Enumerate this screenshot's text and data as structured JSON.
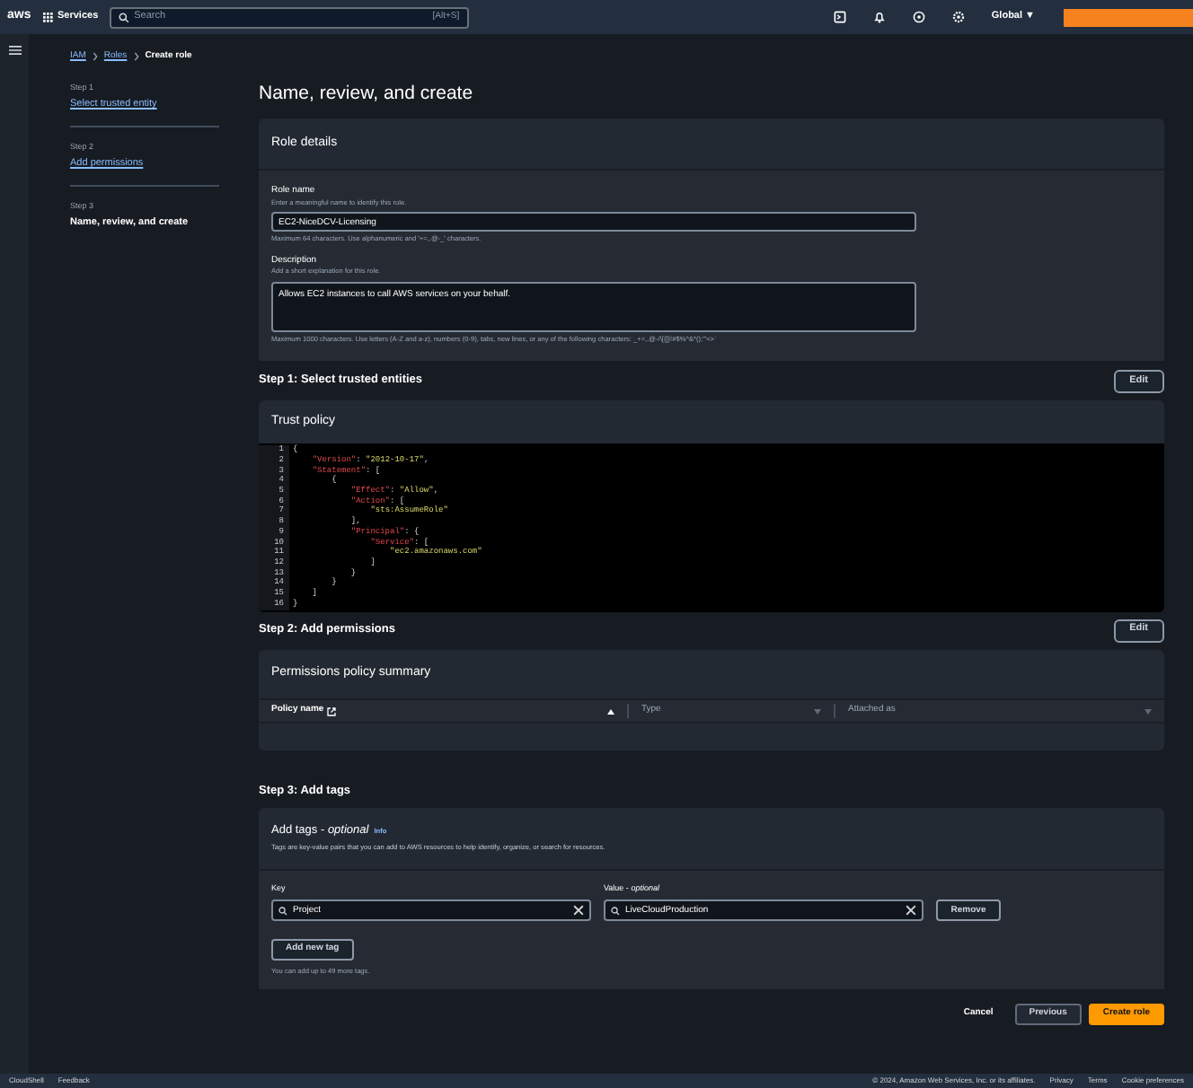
{
  "top_bar": {
    "logo": "aws",
    "services": "Services",
    "search": {
      "placeholder": "Search",
      "shortcut": "[Alt+S]"
    },
    "region": "Global ▼"
  },
  "breadcrumb": [
    {
      "label": "IAM",
      "link": true
    },
    {
      "label": "Roles",
      "link": true
    },
    {
      "label": "Create role",
      "link": false
    }
  ],
  "steps": [
    {
      "step": "Step 1",
      "label": "Select trusted entity",
      "selected": false
    },
    {
      "step": "Step 2",
      "label": "Add permissions",
      "selected": false
    },
    {
      "step": "Step 3",
      "label": "Name, review, and create",
      "selected": true
    }
  ],
  "title": "Name, review, and create",
  "role_details": {
    "title": "Role details",
    "name_label": "Role name",
    "name_hint": "Enter a meaningful name to identify this role.",
    "name_value": "EC2-NiceDCV-Licensing",
    "name_constraint": "Maximum 64 characters. Use alphanumeric and '+=,.@-_' characters.",
    "description_label": "Description",
    "description_hint": "Add a short explanation for this role.",
    "description_value": "Allows EC2 instances to call AWS services on your behalf.",
    "description_constraint": "Maximum 1000 characters. Use letters (A-Z and a-z), numbers (0-9), tabs, new lines, or any of the following characters: _+=,.@-/\\[{]}!#$%^&*();'\"<>`"
  },
  "step1": {
    "title": "Step 1: Select trusted entities",
    "edit": "Edit",
    "panel_title": "Trust policy",
    "code": [
      {
        "number": "1",
        "text": "{"
      },
      {
        "number": "2",
        "text": "    \"Version\": \"2012-10-17\","
      },
      {
        "number": "3",
        "text": "    \"Statement\": ["
      },
      {
        "number": "4",
        "text": "        {"
      },
      {
        "number": "5",
        "text": "            \"Effect\": \"Allow\","
      },
      {
        "number": "6",
        "text": "            \"Action\": ["
      },
      {
        "number": "7",
        "text": "                \"sts:AssumeRole\""
      },
      {
        "number": "8",
        "text": "            ],"
      },
      {
        "number": "9",
        "text": "            \"Principal\": {"
      },
      {
        "number": "10",
        "text": "                \"Service\": ["
      },
      {
        "number": "11",
        "text": "                    \"ec2.amazonaws.com\""
      },
      {
        "number": "12",
        "text": "                ]"
      },
      {
        "number": "13",
        "text": "            }"
      },
      {
        "number": "14",
        "text": "        }"
      },
      {
        "number": "15",
        "text": "    ]"
      },
      {
        "number": "16",
        "text": "}"
      }
    ]
  },
  "step2": {
    "title": "Step 2: Add permissions",
    "edit": "Edit",
    "panel_title": "Permissions policy summary",
    "columns": [
      {
        "label": "Policy name",
        "external": true,
        "sorted": true
      },
      {
        "label": "Type",
        "external": false,
        "sorted": false
      },
      {
        "label": "Attached as",
        "external": false,
        "sorted": false
      }
    ]
  },
  "step3": {
    "title": "Step 3: Add tags",
    "panel_title": "Add tags - *optional*",
    "info": "Info",
    "description": "Tags are key-value pairs that you can add to AWS resources to help identify, organize, or search for resources.",
    "key_label": "Key",
    "value_label": "Value - *optional*",
    "tags": [
      {
        "key": "Project",
        "value": "LiveCloudProduction"
      }
    ],
    "remove": "Remove",
    "add": "Add new tag",
    "limit": "You can add up to 49 more tags."
  },
  "actions": [
    {
      "label": "Cancel",
      "kind": "link"
    },
    {
      "label": "Previous",
      "kind": "secondary"
    },
    {
      "label": "Create role",
      "kind": "primary"
    }
  ],
  "footer": {
    "cloudshell": "CloudShell",
    "feedback": "Feedback",
    "copyright": "© 2024, Amazon Web Services, Inc. or its affiliates.",
    "links": [
      "Privacy",
      "Terms",
      "Cookie preferences"
    ]
  }
}
